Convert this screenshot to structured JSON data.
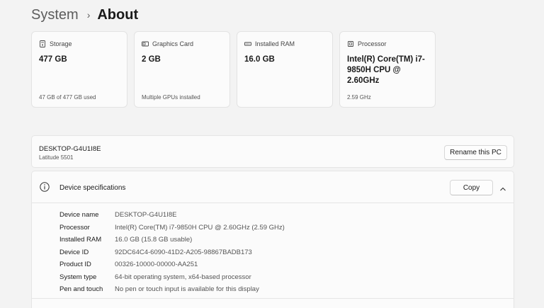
{
  "breadcrumb": {
    "parent": "System",
    "separator": "›",
    "current": "About"
  },
  "cards": [
    {
      "title": "Storage",
      "icon": "storage-icon",
      "value": "477 GB",
      "sub": "47 GB of 477 GB used"
    },
    {
      "title": "Graphics Card",
      "icon": "graphics-card-icon",
      "value": "2 GB",
      "sub": "Multiple GPUs installed"
    },
    {
      "title": "Installed RAM",
      "icon": "ram-icon",
      "value": "16.0 GB",
      "sub": ""
    },
    {
      "title": "Processor",
      "icon": "processor-icon",
      "value": "Intel(R) Core(TM) i7-9850H CPU @ 2.60GHz",
      "sub": "2.59 GHz"
    }
  ],
  "pc": {
    "name": "DESKTOP-G4U1I8E",
    "model": "Latitude 5501",
    "rename_label": "Rename this PC"
  },
  "specs": {
    "title": "Device specifications",
    "copy_label": "Copy",
    "rows": [
      {
        "label": "Device name",
        "value": "DESKTOP-G4U1I8E"
      },
      {
        "label": "Processor",
        "value": "Intel(R) Core(TM) i7-9850H CPU @ 2.60GHz (2.59 GHz)"
      },
      {
        "label": "Installed RAM",
        "value": "16.0 GB (15.8 GB usable)"
      },
      {
        "label": "Device ID",
        "value": "92DC64C4-6090-41D2-A205-98867BADB173"
      },
      {
        "label": "Product ID",
        "value": "00326-10000-00000-AA251"
      },
      {
        "label": "System type",
        "value": "64-bit operating system, x64-based processor"
      },
      {
        "label": "Pen and touch",
        "value": "No pen or touch input is available for this display"
      }
    ]
  }
}
